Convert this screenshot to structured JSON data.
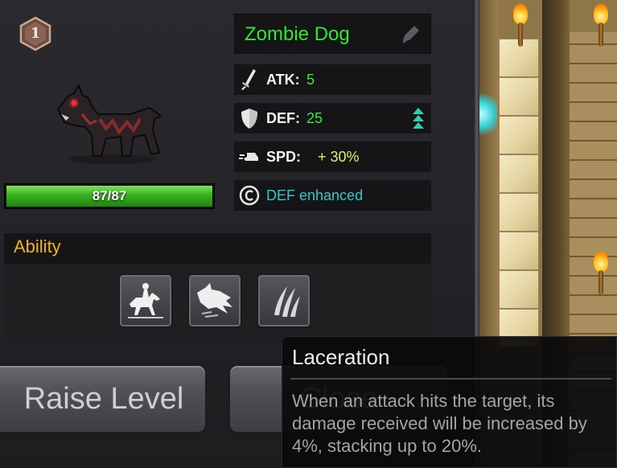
{
  "level": "1",
  "unit": {
    "name": "Zombie Dog",
    "hp_text": "87/87",
    "hp_fraction": 1.0
  },
  "stats": {
    "atk": {
      "label": "ATK:",
      "value": "5"
    },
    "def": {
      "label": "DEF:",
      "value": "25"
    },
    "spd": {
      "label": "SPD:",
      "value": "+ 30%"
    },
    "status": "DEF enhanced"
  },
  "ability": {
    "title": "Ability",
    "skills": [
      "mounted-charge-icon",
      "wolf-rush-icon",
      "claw-slash-icon"
    ]
  },
  "buttons": {
    "raise_level": "Raise Level",
    "close": "Close"
  },
  "tooltip": {
    "title": "Laceration",
    "description": "When an attack hits the target, its damage received will be increased by 4%, stacking up to 20%."
  },
  "colors": {
    "name": "#2fe82f",
    "stat_value": "#3de83d",
    "spd_value": "#d9f56a",
    "status": "#35c8c8",
    "ability_title": "#f2b21c",
    "hp_bar": "#38b01e"
  }
}
